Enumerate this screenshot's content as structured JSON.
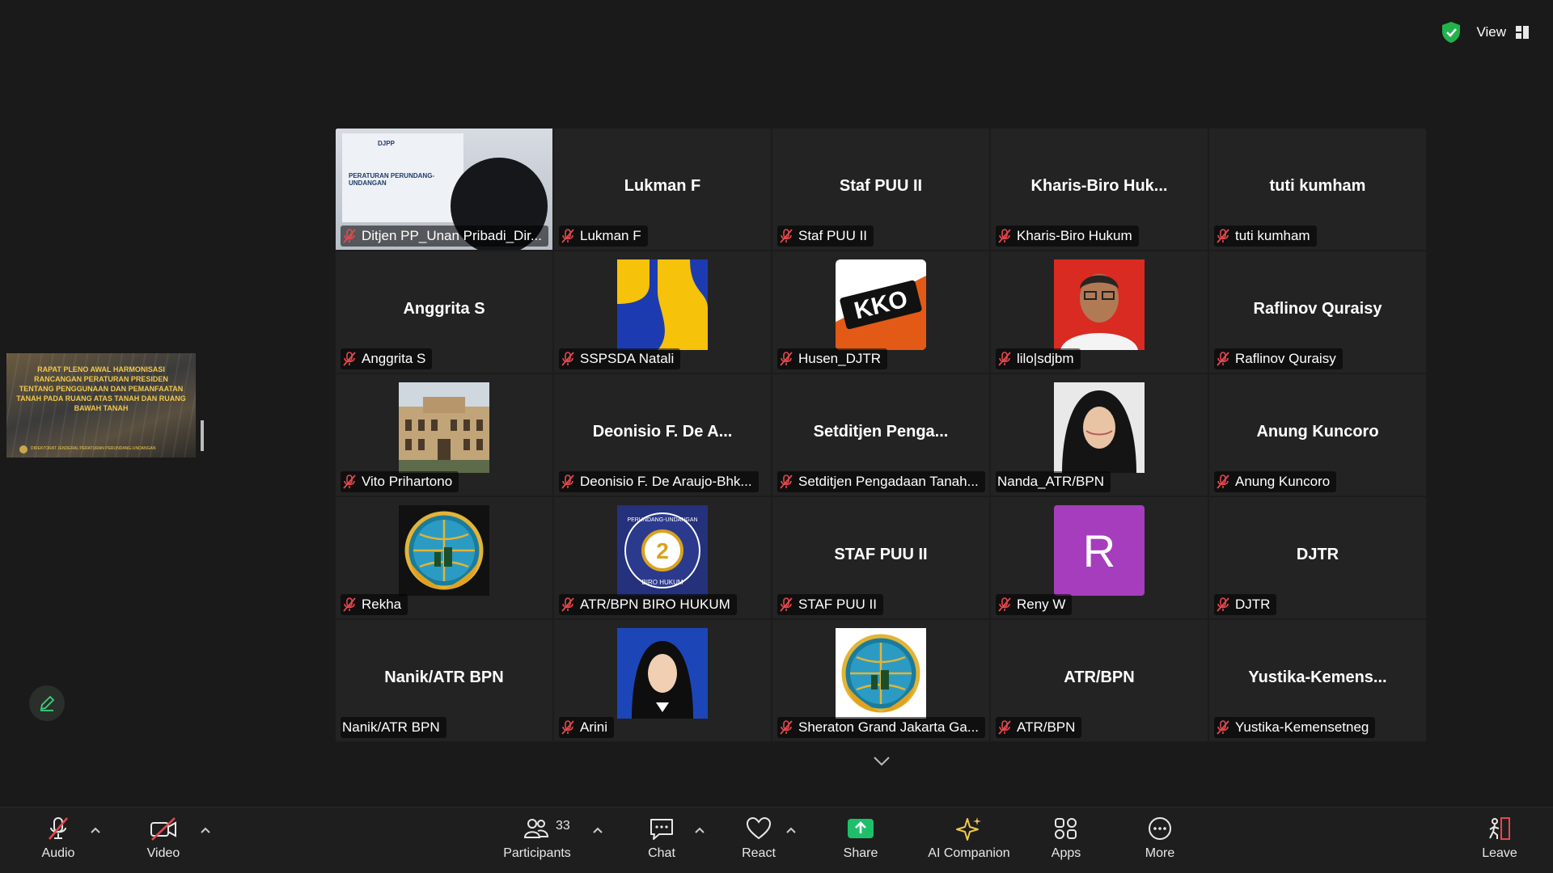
{
  "top_bar": {
    "view_label": "View"
  },
  "side_share_thumbnail": {
    "title": "RAPAT PLENO AWAL HARMONISASI RANCANGAN PERATURAN PRESIDEN TENTANG PENGGUNAAN DAN PEMANFAATAN TANAH PADA RUANG ATAS TANAH DAN RUANG BAWAH TANAH",
    "footer": "DIREKTORAT JENDERAL PERATURAN PERUNDANG-UNDANGAN"
  },
  "share_tile": {
    "doc_text": "PERATURAN PERUNDANG-UNDANGAN",
    "badge": "DJPP"
  },
  "tiles": [
    {
      "name": "Ditjen PP_Unan Pribadi_Dir...",
      "type": "share",
      "muted": true
    },
    {
      "name": "Lukman F",
      "big": "Lukman F",
      "type": "text",
      "muted": true
    },
    {
      "name": "Staf PUU II",
      "big": "Staf PUU II",
      "type": "text",
      "muted": true
    },
    {
      "name": "Kharis-Biro Hukum",
      "big": "Kharis-Biro  Huk...",
      "type": "text",
      "muted": true
    },
    {
      "name": "tuti kumham",
      "big": "tuti kumham",
      "type": "text",
      "muted": true
    },
    {
      "name": "Anggrita S",
      "big": "Anggrita S",
      "type": "text",
      "muted": true
    },
    {
      "name": "SSPSDA Natali",
      "type": "pu-logo",
      "muted": true
    },
    {
      "name": "Husen_DJTR",
      "type": "kko-logo",
      "muted": true
    },
    {
      "name": "lilo|sdjbm",
      "type": "photo-man",
      "muted": true
    },
    {
      "name": "Raflinov Quraisy",
      "big": "Raflinov Quraisy",
      "type": "text",
      "muted": true
    },
    {
      "name": "Vito Prihartono",
      "type": "photo-building",
      "muted": true
    },
    {
      "name": "Deonisio F. De Araujo-Bhk...",
      "big": "Deonisio F. De A...",
      "type": "text",
      "muted": true
    },
    {
      "name": "Setditjen Pengadaan Tanah...",
      "big": "Setditjen  Penga...",
      "type": "text",
      "muted": true
    },
    {
      "name": "Nanda_ATR/BPN",
      "type": "photo-woman",
      "muted": false
    },
    {
      "name": "Anung Kuncoro",
      "big": "Anung Kuncoro",
      "type": "text",
      "muted": true
    },
    {
      "name": "Rekha",
      "type": "atr-logo",
      "muted": true
    },
    {
      "name": "ATR/BPN BIRO HUKUM",
      "type": "biro-logo",
      "muted": true
    },
    {
      "name": "STAF PUU II",
      "big": "STAF PUU II",
      "type": "text",
      "muted": true
    },
    {
      "name": "Reny W",
      "type": "letter",
      "letter": "R",
      "muted": true
    },
    {
      "name": "DJTR",
      "big": "DJTR",
      "type": "text",
      "muted": true
    },
    {
      "name": "Nanik/ATR BPN",
      "big": "Nanik/ATR BPN",
      "type": "text",
      "muted": false
    },
    {
      "name": "Arini",
      "type": "photo-hijab",
      "muted": true
    },
    {
      "name": "Sheraton Grand Jakarta Ga...",
      "type": "atr-logo-white",
      "muted": true
    },
    {
      "name": "ATR/BPN",
      "big": "ATR/BPN",
      "type": "text",
      "muted": true
    },
    {
      "name": "Yustika-Kemensetneg",
      "big": "Yustika-Kemens...",
      "type": "text",
      "muted": true
    }
  ],
  "biro_logo_text": {
    "top": "PERUNDANG-UNDANGAN",
    "number": "2",
    "bottom": "BIRO HUKUM"
  },
  "kko_logo_text": "KKO",
  "toolbar": {
    "audio": "Audio",
    "video": "Video",
    "participants": "Participants",
    "participants_count": "33",
    "chat": "Chat",
    "react": "React",
    "share": "Share",
    "ai_companion": "AI Companion",
    "apps": "Apps",
    "more": "More",
    "leave": "Leave"
  },
  "colors": {
    "letter_avatar": "#a53dbd",
    "share_green": "#1fbf6a",
    "mute_red": "#e5484d"
  }
}
